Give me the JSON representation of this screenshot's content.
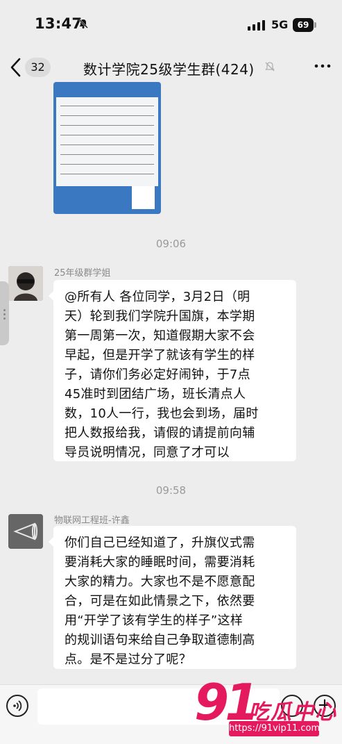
{
  "status_bar": {
    "time": "13:47",
    "network": "5G",
    "battery": "69"
  },
  "nav": {
    "unread_count": "32",
    "title": "数计学院25级学生群(424)"
  },
  "messages": [
    {
      "type": "timestamp",
      "text": "09:06"
    },
    {
      "type": "text",
      "sender": "25年级群学姐",
      "lines": [
        "@所有人 各位同学，3月2日（明",
        "天）轮到我们学院升国旗，本学期",
        "第一周第一次，知道假期大家不会",
        "早起，但是开学了就该有学生的样",
        "子，请你们务必定好闹钟，于7点",
        "45准时到团结广场，班长清点人",
        "数，10人一行，我也会到场，届时",
        "把人数报给我，请假的请提前向辅",
        "导员说明情况，同意了才可以"
      ]
    },
    {
      "type": "timestamp",
      "text": "09:58"
    },
    {
      "type": "text",
      "sender": "物联网工程班-许鑫",
      "lines": [
        "你们自己已经知道了，升旗仪式需",
        "要消耗大家的睡眠时间，需要消耗",
        "大家的精力。大家也不是不愿意配",
        "合，可是在如此情景之下，依然要",
        "用“开学了该有学生的样子”这样",
        "的规训语句来给自己争取道德制高",
        "点。是不是过分了呢？"
      ]
    }
  ],
  "watermark": {
    "number": "91",
    "text": "吃瓜中心",
    "url": "https://91vip11.com"
  },
  "colors": {
    "background": "#ededed",
    "bubble": "#ffffff",
    "watermark": "#e5195e"
  }
}
